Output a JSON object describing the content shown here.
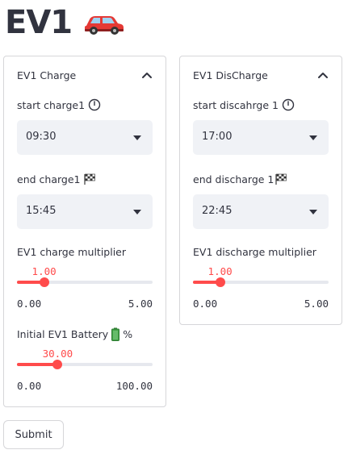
{
  "page": {
    "title": "EV1",
    "title_emoji": "car-icon",
    "accent_color": "#ff4b4b"
  },
  "charge_panel": {
    "title": "EV1 Charge",
    "start_label": "start charge1",
    "start_icon": "clock-icon",
    "start_value": "09:30",
    "end_label": "end charge1",
    "end_icon": "checkered-flag-icon",
    "end_value": "15:45",
    "multiplier": {
      "label": "EV1 charge multiplier",
      "value": 1.0,
      "value_text": "1.00",
      "min": 0,
      "max": 5,
      "min_text": "0.00",
      "max_text": "5.00"
    },
    "battery": {
      "label": "Initial EV1 Battery",
      "icon": "battery-icon",
      "suffix": "%",
      "value": 30,
      "value_text": "30.00",
      "min": 0,
      "max": 100,
      "min_text": "0.00",
      "max_text": "100.00"
    }
  },
  "discharge_panel": {
    "title": "EV1 DisCharge",
    "start_label": "start discahrge 1",
    "start_icon": "clock-icon",
    "start_value": "17:00",
    "end_label": "end discharge 1",
    "end_icon": "checkered-flag-icon",
    "end_value": "22:45",
    "multiplier": {
      "label": "EV1 discharge multiplier",
      "value": 1.0,
      "value_text": "1.00",
      "min": 0,
      "max": 5,
      "min_text": "0.00",
      "max_text": "5.00"
    }
  },
  "form": {
    "submit_label": "Submit"
  }
}
